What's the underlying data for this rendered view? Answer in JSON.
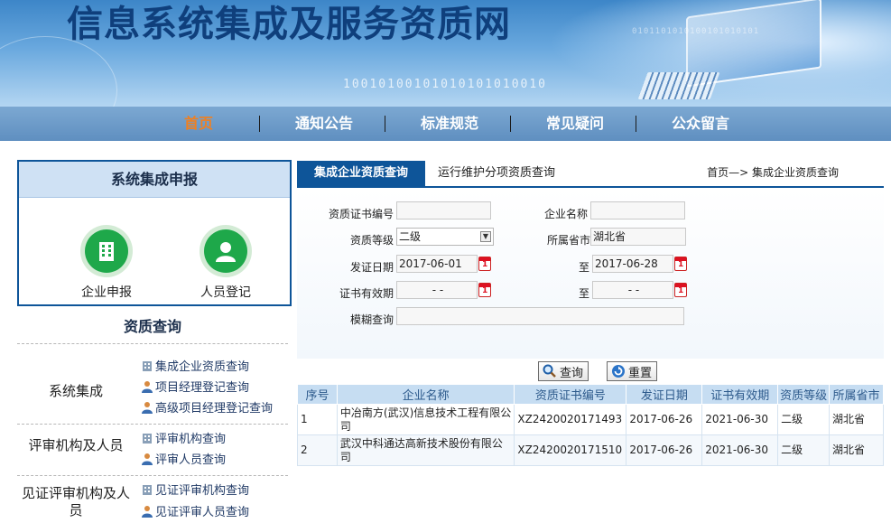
{
  "banner": {
    "site_title": "信息系统集成及服务资质网",
    "binary_text": "10010100101010101010010",
    "binary_small": "0101101010100101010101"
  },
  "nav": {
    "items": [
      "首页",
      "通知公告",
      "标准规范",
      "常见疑问",
      "公众留言"
    ],
    "active_index": 0,
    "active_color": "#f08020"
  },
  "report": {
    "title": "系统集成申报",
    "items": [
      {
        "label": "企业申报",
        "icon": "building-icon"
      },
      {
        "label": "人员登记",
        "icon": "person-icon"
      }
    ]
  },
  "qualification_query": {
    "title": "资质查询",
    "categories": [
      {
        "label": "系统集成",
        "links": [
          "集成企业资质查询",
          "项目经理登记查询",
          "高级项目经理登记查询"
        ]
      },
      {
        "label": "评审机构及人员",
        "links": [
          "评审机构查询",
          "评审人员查询"
        ]
      },
      {
        "label": "见证评审机构及人员",
        "links": [
          "见证评审机构查询",
          "见证评审人员查询"
        ]
      }
    ]
  },
  "tabs": {
    "active": "集成企业资质查询",
    "other": "运行维护分项资质查询",
    "breadcrumb": "首页—> 集成企业资质查询"
  },
  "form": {
    "cert_no_label": "资质证书编号",
    "cert_no_value": "",
    "company_label": "企业名称",
    "company_value": "",
    "level_label": "资质等级",
    "level_value": "二级",
    "region_label": "所属省市",
    "region_value": "湖北省",
    "issue_date_label": "发证日期",
    "issue_date_from": "2017-06-01",
    "to_label": "至",
    "issue_date_to": "2017-06-28",
    "valid_label": "证书有效期",
    "valid_from": "- -",
    "valid_to": "- -",
    "fuzzy_label": "模糊查询",
    "fuzzy_value": ""
  },
  "buttons": {
    "search": "查询",
    "reset": "重置"
  },
  "table": {
    "headers": [
      "序号",
      "企业名称",
      "资质证书编号",
      "发证日期",
      "证书有效期",
      "资质等级",
      "所属省市"
    ],
    "rows": [
      [
        "1",
        "中冶南方(武汉)信息技术工程有限公司",
        "XZ2420020171493",
        "2017-06-26",
        "2021-06-30",
        "二级",
        "湖北省"
      ],
      [
        "2",
        "武汉中科通达高新技术股份有限公司",
        "XZ2420020171510",
        "2017-06-26",
        "2021-06-30",
        "二级",
        "湖北省"
      ]
    ]
  },
  "colors": {
    "primary": "#0e5599",
    "nav_bg": "#6b9ac8",
    "icon_green": "#1ea84a",
    "header_blue": "#c6ddf2"
  }
}
